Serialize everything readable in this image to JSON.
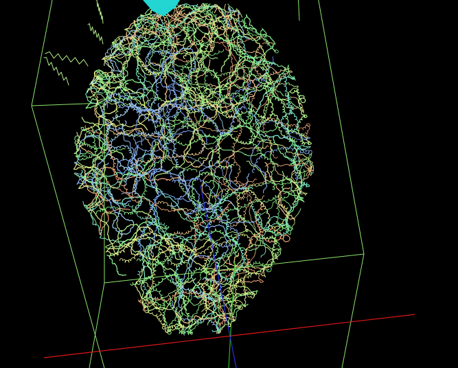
{
  "viewer": {
    "background_color": "#000000",
    "unit_cell_color": "#8CE66E",
    "axis_x_color": "#E01818",
    "axis_y_color": "#2AB82A",
    "axis_z_color": "#2E2EE6",
    "marker_color": "#23D6D2",
    "marker_icon": "cyan-polyhedron-marker"
  },
  "structure": {
    "representation": "backbone-trace",
    "palette": [
      "#8CF08C",
      "#B4F08C",
      "#E6F08C",
      "#F0C88C",
      "#F0A878",
      "#8CB4F0",
      "#78A0F0",
      "#A0D2F0",
      "#7CE6C8"
    ]
  }
}
